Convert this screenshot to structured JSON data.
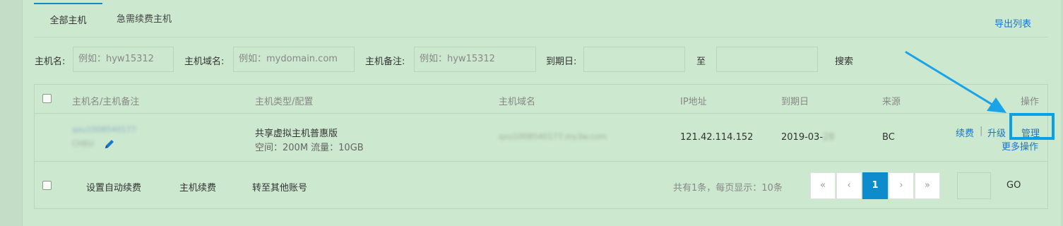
{
  "tabs": [
    {
      "label": "全部主机",
      "active": true
    },
    {
      "label": "急需续费主机",
      "active": false
    }
  ],
  "export_label": "导出列表",
  "filters": {
    "host_name_label": "主机名:",
    "host_name_placeholder": "例如：hyw15312",
    "domain_label": "主机域名:",
    "domain_placeholder": "例如：mydomain.com",
    "remark_label": "主机备注:",
    "remark_placeholder": "例如：hyw15312",
    "expiry_label": "到期日:",
    "to_label": "至",
    "search_label": "搜索"
  },
  "table": {
    "headers": [
      "主机名/主机备注",
      "主机类型/配置",
      "主机域名",
      "IP地址",
      "到期日",
      "来源",
      "操作"
    ],
    "row": {
      "host_name": "qxu1008540177",
      "remark": "CHEU",
      "type": "共享虚拟主机普惠版",
      "config": "空间：200M 流量：10GB",
      "domain": "qxu1008540177.my3w.com",
      "ip": "121.42.114.152",
      "expiry_prefix": "2019-03-",
      "expiry_suffix": "28",
      "source": "BC",
      "actions": {
        "renew": "续费",
        "separator": "|",
        "upgrade": "升级",
        "manage": "管理",
        "more": "更多操作"
      }
    }
  },
  "footer": {
    "auto_renew": "设置自动续费",
    "renew": "主机续费",
    "transfer": "转至其他账号",
    "summary": "共有1条，每页显示：10条",
    "pager": [
      "«",
      "‹",
      "1",
      "›",
      "»"
    ],
    "current_page": 1,
    "go_label": "GO"
  },
  "colors": {
    "background": "#cce8cf",
    "link": "#1a76c8",
    "accent": "#0aa0e6",
    "page_active": "#0c8ccc"
  },
  "icons": {
    "edit": "pencil-icon",
    "annotation": "arrow-icon"
  }
}
